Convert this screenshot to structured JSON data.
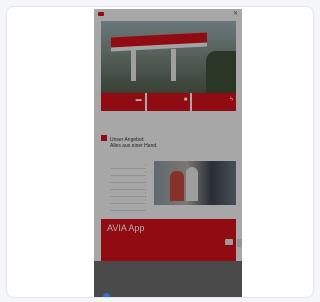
{
  "hero": {
    "text_lines": [
      "",
      "",
      ""
    ]
  },
  "features": [
    {
      "label": "",
      "icon": "tag-icon"
    },
    {
      "label": "",
      "icon": "car-icon"
    },
    {
      "label": "",
      "icon": "bolt-icon"
    }
  ],
  "section": {
    "heading_line1": "Unser Angebot:",
    "heading_line2": "Alles aus einer Hand."
  },
  "services": [
    "",
    "",
    "",
    "",
    "",
    "",
    ""
  ],
  "app": {
    "title": "AVIA App",
    "lines": [
      "",
      "",
      "",
      "",
      ""
    ]
  },
  "cookie": {
    "title": "",
    "text": "",
    "settings_label": "",
    "accept_label": ""
  },
  "colors": {
    "brand": "#d6121b",
    "accept": "#3aa845",
    "badge": "#2f6fd6"
  }
}
